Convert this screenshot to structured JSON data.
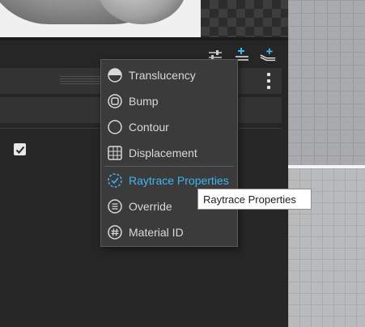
{
  "menu": {
    "items": [
      {
        "label": "Translucency",
        "icon": "half-circle-icon",
        "active": false
      },
      {
        "label": "Bump",
        "icon": "rounded-square-icon",
        "active": false
      },
      {
        "label": "Contour",
        "icon": "circle-icon",
        "active": false
      },
      {
        "label": "Displacement",
        "icon": "displacement-grid-icon",
        "active": false
      },
      {
        "label": "Raytrace Properties",
        "icon": "dashed-check-circle-icon",
        "active": true
      },
      {
        "label": "Override",
        "icon": "list-circle-icon",
        "active": false
      },
      {
        "label": "Material ID",
        "icon": "hash-circle-icon",
        "active": false
      }
    ]
  },
  "tooltip": {
    "text": "Raytrace Properties"
  },
  "colors": {
    "accent": "#3fb6f2",
    "panel": "#262626",
    "menu": "#3b3b3b",
    "menu_text": "#d9d9d9"
  },
  "toolbar": {
    "icons": [
      "sliders-icon",
      "add-list-icon",
      "add-layers-icon"
    ]
  },
  "option_checkbox": {
    "checked": true
  }
}
